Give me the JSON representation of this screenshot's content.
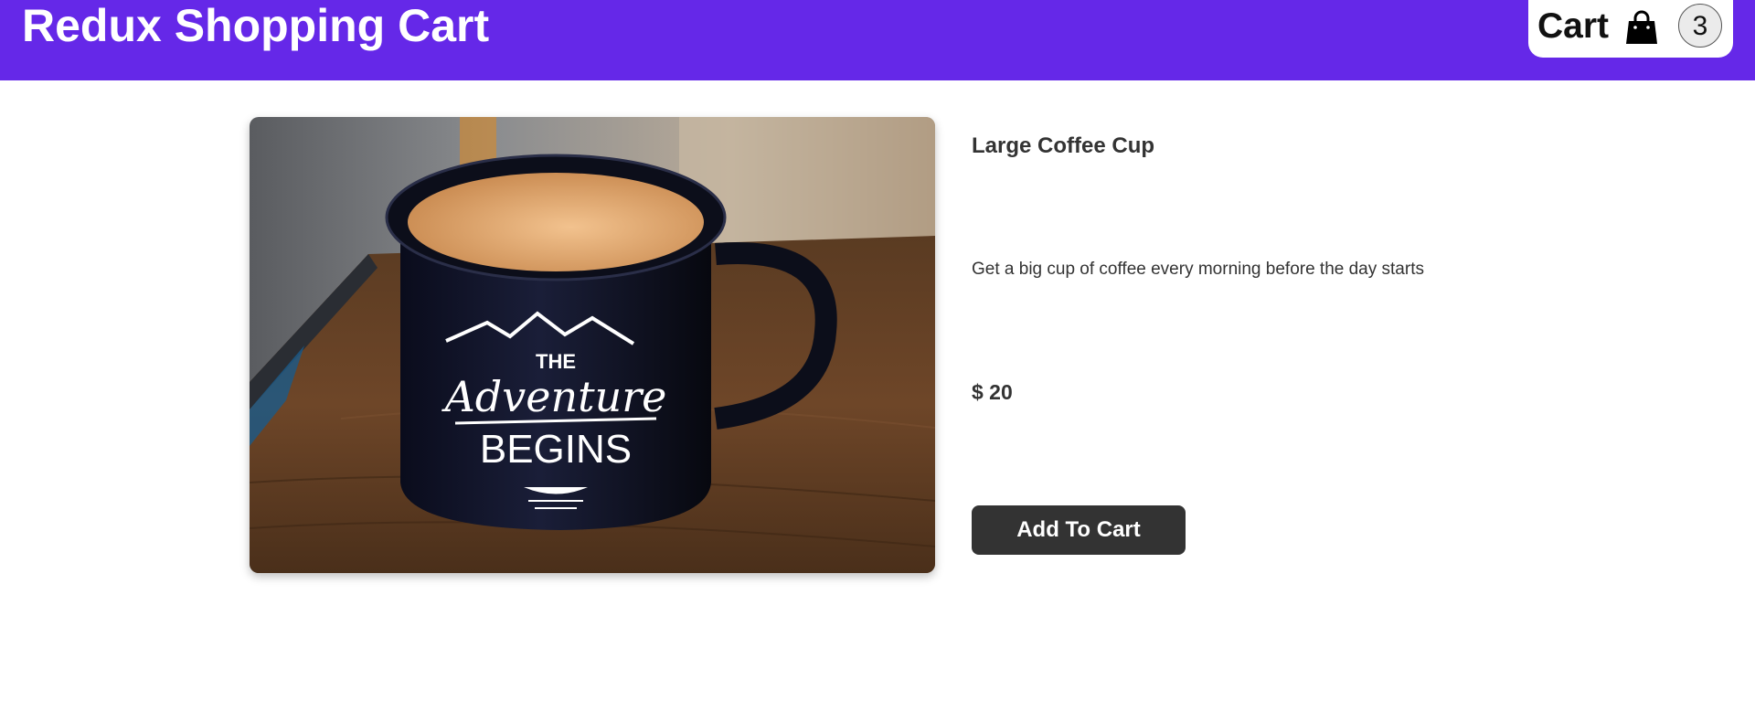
{
  "header": {
    "title": "Redux Shopping Cart",
    "background_color": "#6528e8",
    "cart": {
      "label": "Cart",
      "icon": "shopping-bag-icon",
      "count": "3"
    }
  },
  "product": {
    "name": "Large Coffee Cup",
    "description": "Get a big cup of coffee every morning before the day starts",
    "price": "$ 20",
    "image": {
      "mug_text_small": "THE",
      "mug_text_script": "Adventure",
      "mug_text_large": "BEGINS"
    },
    "add_button_label": "Add To Cart"
  }
}
